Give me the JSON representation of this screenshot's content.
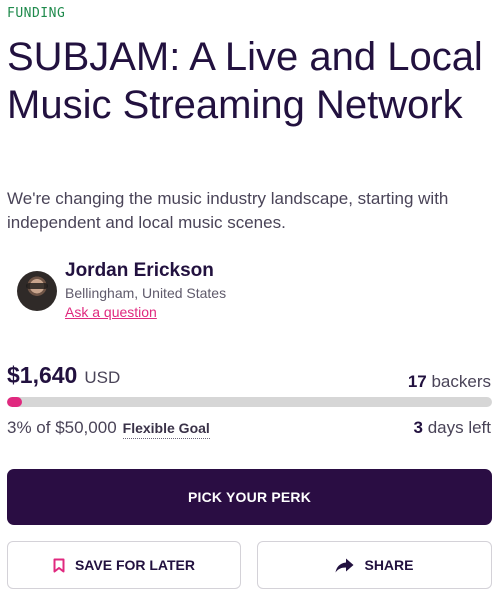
{
  "eyebrow": "FUNDING",
  "title": "SUBJAM: A Live and Local Music Streaming Network",
  "subtitle": "We're changing the music industry landscape, starting with independent and local music scenes.",
  "owner": {
    "name": "Jordan Erickson",
    "location": "Bellingham, United States",
    "ask_link": "Ask a question"
  },
  "funding": {
    "amount": "$1,640",
    "currency": "USD",
    "backers_count": "17",
    "backers_label": "backers",
    "progress_fraction": 0.03,
    "percent_text": "3% of $50,000",
    "goal_type": "Flexible Goal",
    "days_count": "3",
    "days_label": "days left"
  },
  "actions": {
    "primary": "PICK YOUR PERK",
    "save": "SAVE FOR LATER",
    "share": "SHARE"
  },
  "colors": {
    "accent": "#e0297f",
    "primary_button": "#2a0d43",
    "eyebrow": "#1f8a4c"
  },
  "icons": {
    "save": "bookmark-icon",
    "share": "share-arrow-icon"
  }
}
